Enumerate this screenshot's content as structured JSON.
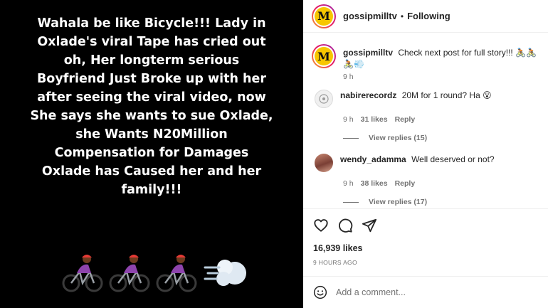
{
  "post": {
    "text": "Wahala be like Bicycle!!! Lady in Oxlade's viral Tape has cried out oh, Her longterm serious Boyfriend Just Broke up with her after seeing the viral video, now She says she wants to sue Oxlade, she Wants N20Million Compensation for Damages Oxlade has Caused her and her family!!!",
    "emojis": [
      "person-biking-emoji",
      "person-biking-emoji",
      "person-biking-emoji",
      "dashing-away-emoji"
    ]
  },
  "header": {
    "username": "gossipmilltv",
    "separator": "•",
    "follow_status": "Following",
    "avatar_letter": "M"
  },
  "caption": {
    "username": "gossipmilltv",
    "text": "Check next post for full story!!! 🚴🏾🚴🏾🚴🏾💨",
    "time": "9 h"
  },
  "comments": [
    {
      "username": "nabirerecordz",
      "text": "20M for 1 round? Ha 😮",
      "time": "9 h",
      "likes": "31 likes",
      "reply_label": "Reply",
      "view_replies": "View replies (15)"
    },
    {
      "username": "wendy_adamma",
      "text": "Well deserved or not?",
      "time": "9 h",
      "likes": "38 likes",
      "reply_label": "Reply",
      "view_replies": "View replies (17)"
    }
  ],
  "actions": {
    "like_icon": "heart-icon",
    "comment_icon": "comment-icon",
    "share_icon": "paper-plane-icon",
    "likes_count": "16,939 likes",
    "posted": "9 HOURS AGO"
  },
  "add_comment": {
    "placeholder": "Add a comment...",
    "emoji_icon": "smiley-icon"
  },
  "colors": {
    "media_background": "#000000",
    "logo_yellow": "#f7c600",
    "muted_text": "#737373"
  }
}
